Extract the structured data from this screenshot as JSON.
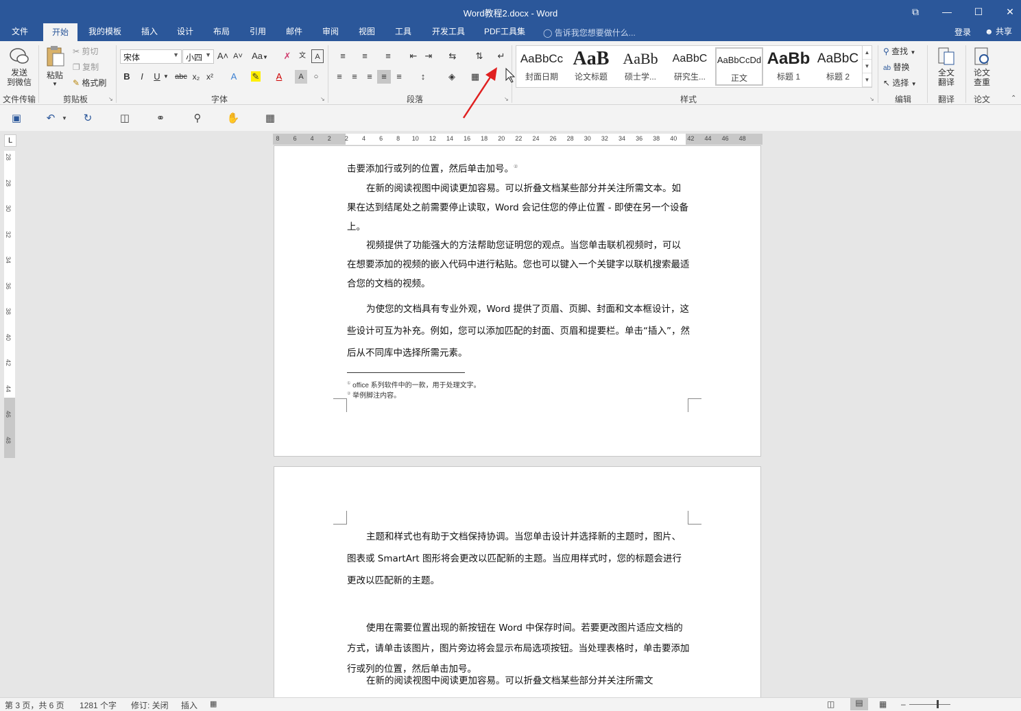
{
  "window": {
    "title": "Word教程2.docx - Word",
    "controls": {
      "restore": "⧉",
      "minimize": "—",
      "maximize": "☐",
      "close": "✕"
    }
  },
  "tabs": [
    "文件",
    "开始",
    "我的模板",
    "插入",
    "设计",
    "布局",
    "引用",
    "邮件",
    "审阅",
    "视图",
    "工具",
    "开发工具",
    "PDF工具集"
  ],
  "active_tab": "开始",
  "tellme": "告诉我您想要做什么...",
  "login": "登录",
  "share": "共享",
  "ribbon": {
    "file_transfer": {
      "button": "发送\n到微信",
      "label": "文件传输"
    },
    "clipboard": {
      "paste": "粘贴",
      "cut": "剪切",
      "copy": "复制",
      "format_painter": "格式刷",
      "label": "剪贴板"
    },
    "font": {
      "font_name": "宋体",
      "font_size": "小四",
      "label": "字体",
      "case": "Aa",
      "bold": "B",
      "italic": "I",
      "underline": "U",
      "strike": "abc",
      "sub": "x₂",
      "sup": "x²",
      "grow": "A˄",
      "shrink": "A˅"
    },
    "paragraph": {
      "label": "段落"
    },
    "styles": {
      "label": "样式",
      "items": [
        {
          "preview": "AaBbCc",
          "name": "封面日期"
        },
        {
          "preview": "AaB",
          "name": "论文标题"
        },
        {
          "preview": "AaBb",
          "name": "硕士学..."
        },
        {
          "preview": "AaBbC",
          "name": "研究生..."
        },
        {
          "preview": "AaBbCcDd",
          "name": "正文"
        },
        {
          "preview": "AaBb",
          "name": "标题 1"
        },
        {
          "preview": "AaBbC",
          "name": "标题 2"
        }
      ]
    },
    "editing": {
      "find": "查找",
      "replace": "替换",
      "select": "选择",
      "label": "编辑"
    },
    "translate": {
      "button": "全文\n翻译",
      "label": "翻译"
    },
    "paper": {
      "button": "论文\n查重",
      "label": "论文"
    }
  },
  "ruler": {
    "h_ticks": [
      "8",
      "6",
      "4",
      "2",
      "2",
      "4",
      "6",
      "8",
      "10",
      "12",
      "14",
      "16",
      "18",
      "20",
      "22",
      "24",
      "26",
      "28",
      "30",
      "32",
      "34",
      "36",
      "38",
      "40",
      "42",
      "44",
      "46",
      "48"
    ],
    "v_ticks": [
      "28",
      "28",
      "30",
      "32",
      "34",
      "36",
      "38",
      "40",
      "42",
      "44",
      "46",
      "48"
    ]
  },
  "page1": {
    "partial_top": "击要添加行或列的位置，然后单击加号。",
    "footnote_ref": "②",
    "p1": "在新的阅读视图中阅读更加容易。可以折叠文档某些部分并关注所需文本。如果在达到结尾处之前需要停止读取，Word 会记住您的停止位置 - 即使在另一个设备上。",
    "p2": "视频提供了功能强大的方法帮助您证明您的观点。当您单击联机视频时，可以在想要添加的视频的嵌入代码中进行粘贴。您也可以键入一个关键字以联机搜索最适合您的文档的视频。",
    "p3": "为使您的文档具有专业外观，Word 提供了页眉、页脚、封面和文本框设计，这些设计可互为补充。例如，您可以添加匹配的封面、页眉和提要栏。单击“插入”，然后从不同库中选择所需元素。",
    "footnotes": [
      {
        "mark": "①",
        "text": "office 系列软件中的一款，用于处理文字。"
      },
      {
        "mark": "②",
        "text": "举例脚注内容。"
      }
    ]
  },
  "page2": {
    "p1": "主题和样式也有助于文档保持协调。当您单击设计并选择新的主题时，图片、图表或 SmartArt 图形将会更改以匹配新的主题。当应用样式时，您的标题会进行更改以匹配新的主题。",
    "p2": "使用在需要位置出现的新按钮在 Word 中保存时间。若要更改图片适应文档的方式，请单击该图片，图片旁边将会显示布局选项按钮。当处理表格时，单击要添加行或列的位置，然后单击加号。",
    "p3": "在新的阅读视图中阅读更加容易。可以折叠文档某些部分并关注所需文"
  },
  "status": {
    "page": "第 3 页，共 6 页",
    "words": "1281 个字",
    "revision": "修订: 关闭",
    "mode": "插入"
  },
  "colors": {
    "brand": "#2b579a",
    "annotation_arrow": "#e02020"
  }
}
